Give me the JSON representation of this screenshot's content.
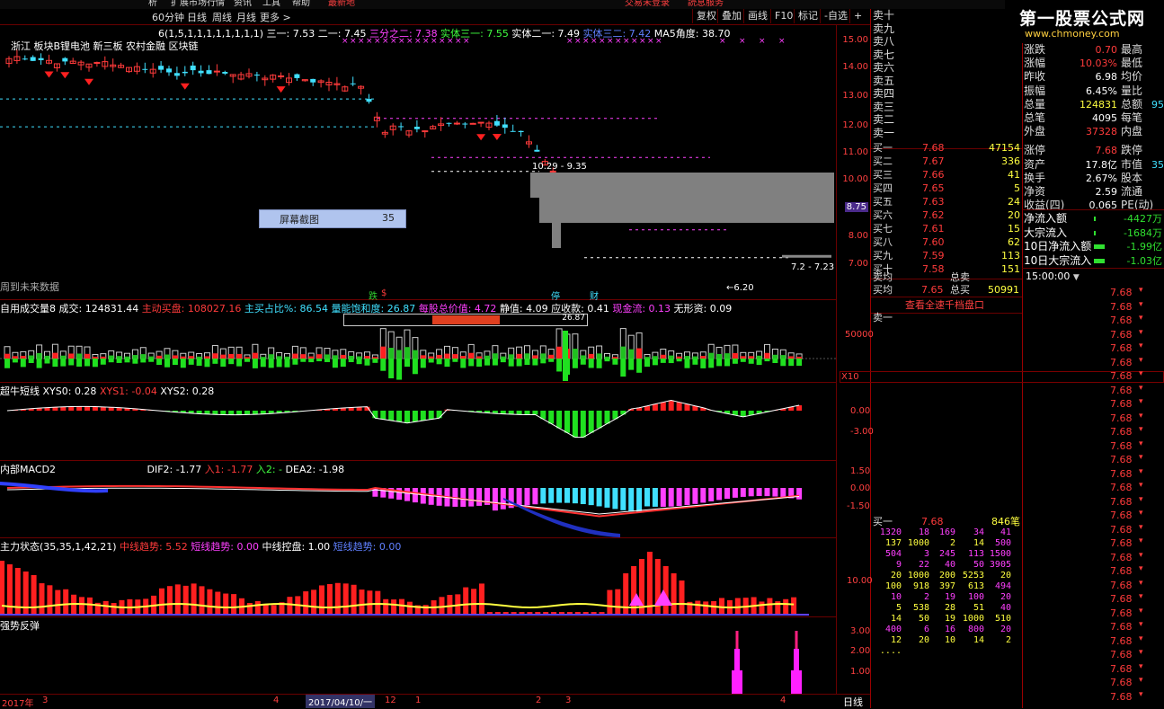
{
  "top_menu": [
    "析",
    "扩展市场行情",
    "资讯",
    "工具",
    "帮助",
    "最新地",
    "交易未登录",
    "読息服务"
  ],
  "period_tabs": [
    "60分钟",
    "日线",
    "周线",
    "月线",
    "更多 >"
  ],
  "toolbar_right": [
    "复权",
    "叠加",
    "画线",
    "F10",
    "标记",
    "-自选",
    "+"
  ],
  "logo": {
    "title": "第一股票公式网",
    "url": "www.chmoney.com"
  },
  "main_chart": {
    "legend_params": "6(1,5,1,1,1,1,1,1,1,1)",
    "legend_items": [
      {
        "label": "三一: 7.53",
        "color": "#ffffff"
      },
      {
        "label": "二一: 7.45",
        "color": "#ffffff"
      },
      {
        "label": "三分之二: 7.38",
        "color": "#ff40ff"
      },
      {
        "label": "实体三一: 7.55",
        "color": "#40ff40"
      },
      {
        "label": "实体二一: 7.49",
        "color": "#ffffff"
      },
      {
        "label": "实体三二: 7.42",
        "color": "#6080ff"
      },
      {
        "label": "MA5角度: 38.70",
        "color": "#ffffff"
      }
    ],
    "concept_tags": "浙江 板块B锂电池 新三板 农村金融 区块链",
    "price_ticks": [
      "15.00",
      "14.00",
      "13.00",
      "12.00",
      "11.00",
      "10.00",
      "8.75",
      "8.00",
      "7.00"
    ],
    "labels": {
      "range1": "10.29 - 9.35",
      "range2": "7.2 - 7.23",
      "low": "←6.20",
      "no_data": "周到未来数据"
    },
    "screenshot_tool": {
      "label": "屏幕截图",
      "value": "35"
    }
  },
  "signals_row": {
    "d": "跌",
    "s": "$",
    "t": "停",
    "c": "财"
  },
  "volume_panel": {
    "title": "自用成交量8",
    "items": [
      {
        "label": "成交: 124831.44",
        "color": "#ffffff"
      },
      {
        "label": "主动买盘: 108027.16",
        "color": "#ff3b3b"
      },
      {
        "label": "主买占比%: 86.54",
        "color": "#40e0ff"
      },
      {
        "label": "量能饱和度: 26.87",
        "color": "#40e0ff"
      },
      {
        "label": "每股总价值: 4.72",
        "color": "#ff40ff"
      },
      {
        "label": "静值: 4.09",
        "color": "#ffffff"
      },
      {
        "label": "应收款: 0.41",
        "color": "#ffffff"
      },
      {
        "label": "现金流: 0.13",
        "color": "#ff40ff"
      },
      {
        "label": "无形资: 0.09",
        "color": "#ffffff"
      }
    ],
    "gauge_value": "26.87",
    "gauge_fraction": 0.2687,
    "ticks": [
      "50000",
      "X10"
    ]
  },
  "short_panel": {
    "title": "超牛短线",
    "items": [
      {
        "label": "XYS0: 0.28",
        "color": "#ffffff"
      },
      {
        "label": "XYS1: -0.04",
        "color": "#ff3b3b"
      },
      {
        "label": "XYS2: 0.28",
        "color": "#ffffff"
      }
    ],
    "ticks": [
      "0.00",
      "-3.00"
    ]
  },
  "macd_panel": {
    "title": "内部MACD2",
    "items": [
      {
        "label": "DIF2: -1.77",
        "color": "#ffffff"
      },
      {
        "label": "入1: -1.77",
        "color": "#ff3b3b"
      },
      {
        "label": "入2: -",
        "color": "#40ff40"
      },
      {
        "label": "DEA2: -1.98",
        "color": "#ffffff"
      }
    ],
    "ticks": [
      "1.50",
      "0.00",
      "-1.50"
    ]
  },
  "main_force_panel": {
    "title": "主力状态(35,35,1,42,21)",
    "items": [
      {
        "label": "中线趋势: 5.52",
        "color": "#ff3b3b"
      },
      {
        "label": "短线趋势: 0.00",
        "color": "#ff40ff"
      },
      {
        "label": "中线控盘: 1.00",
        "color": "#ffffff"
      },
      {
        "label": "短线趋势: 0.00",
        "color": "#6080ff"
      }
    ],
    "ticks": [
      "10.00"
    ]
  },
  "reversal_panel": {
    "title": "强势反弹",
    "ticks": [
      "3.00",
      "2.00",
      "1.00"
    ]
  },
  "bottom_axis": {
    "labels": [
      "2017年",
      "3",
      "4",
      "2017/04/10/一",
      "12",
      "1",
      "2",
      "3",
      "4"
    ],
    "period": "日线"
  },
  "order_book": {
    "sell": [
      "卖十",
      "卖九",
      "卖八",
      "卖七",
      "卖六",
      "卖五",
      "卖四",
      "卖三",
      "卖二",
      "卖一"
    ],
    "buy": [
      {
        "label": "买一",
        "price": "7.68",
        "vol": "47154"
      },
      {
        "label": "买二",
        "price": "7.67",
        "vol": "336"
      },
      {
        "label": "买三",
        "price": "7.66",
        "vol": "41"
      },
      {
        "label": "买四",
        "price": "7.65",
        "vol": "5"
      },
      {
        "label": "买五",
        "price": "7.63",
        "vol": "24"
      },
      {
        "label": "买六",
        "price": "7.62",
        "vol": "20"
      },
      {
        "label": "买七",
        "price": "7.61",
        "vol": "15"
      },
      {
        "label": "买八",
        "price": "7.60",
        "vol": "62"
      },
      {
        "label": "买九",
        "price": "7.59",
        "vol": "113"
      },
      {
        "label": "买十",
        "price": "7.58",
        "vol": "151"
      }
    ],
    "avg_sell": "卖均",
    "total_sell": "总卖",
    "avg_buy": "买均",
    "avg_buy_price": "7.65",
    "total_buy": "总买",
    "total_buy_vol": "50991",
    "view_all": "查看全速千档盘口",
    "sell1": "卖一",
    "buy1_label": "买一",
    "buy1_price": "7.68",
    "buy1_count": "846笔",
    "queue": [
      [
        "1320",
        "18",
        "169",
        "34",
        "41"
      ],
      [
        "137",
        "1000",
        "2",
        "14",
        "500"
      ],
      [
        "504",
        "3",
        "245",
        "113",
        "1500"
      ],
      [
        "9",
        "22",
        "40",
        "50",
        "3905"
      ],
      [
        "20",
        "1000",
        "200",
        "5253",
        "20"
      ],
      [
        "100",
        "918",
        "397",
        "613",
        "494"
      ],
      [
        "10",
        "2",
        "19",
        "100",
        "20"
      ],
      [
        "5",
        "538",
        "28",
        "51",
        "40"
      ],
      [
        "14",
        "50",
        "19",
        "1000",
        "510"
      ],
      [
        "400",
        "6",
        "16",
        "800",
        "20"
      ],
      [
        "12",
        "20",
        "10",
        "14",
        "2"
      ],
      [
        "....",
        "",
        "",
        "",
        ""
      ]
    ]
  },
  "stats": [
    {
      "l": "涨跌",
      "v": "0.70",
      "vc": "#ff3b3b",
      "l2": "最高",
      "v2": ""
    },
    {
      "l": "涨幅",
      "v": "10.03%",
      "vc": "#ff3b3b",
      "l2": "最低",
      "v2": ""
    },
    {
      "l": "昨收",
      "v": "6.98",
      "vc": "#ffffff",
      "l2": "均价",
      "v2": ""
    },
    {
      "l": "振幅",
      "v": "6.45%",
      "vc": "#ffffff",
      "l2": "量比",
      "v2": ""
    },
    {
      "l": "总量",
      "v": "124831",
      "vc": "#ffff40",
      "l2": "总额",
      "v2": "95"
    },
    {
      "l": "总笔",
      "v": "4095",
      "vc": "#ffffff",
      "l2": "每笔",
      "v2": ""
    },
    {
      "l": "外盘",
      "v": "37328",
      "vc": "#ff3b3b",
      "l2": "内盘",
      "v2": ""
    },
    {
      "l": "涨停",
      "v": "7.68",
      "vc": "#ff3b3b",
      "l2": "跌停",
      "v2": ""
    },
    {
      "l": "资产",
      "v": "17.8亿",
      "vc": "#ffffff",
      "l2": "市值",
      "v2": "35"
    },
    {
      "l": "换手",
      "v": "2.67%",
      "vc": "#ffffff",
      "l2": "股本",
      "v2": ""
    },
    {
      "l": "净资",
      "v": "2.59",
      "vc": "#ffffff",
      "l2": "流通",
      "v2": ""
    },
    {
      "l": "收益(四)",
      "v": "0.065",
      "vc": "#ffffff",
      "l2": "PE(动)",
      "v2": ""
    }
  ],
  "flows": [
    {
      "l": "净流入额",
      "v": "-4427万"
    },
    {
      "l": "大宗流入",
      "v": "-1684万"
    },
    {
      "l": "10日净流入额",
      "v": "-1.99亿"
    },
    {
      "l": "10日大宗流入",
      "v": "-1.03亿"
    }
  ],
  "ticks_list": {
    "time": "15:00:00",
    "price": "7.68"
  },
  "colors": {
    "up": "#ff3b3b",
    "down": "#30d030",
    "grid": "#6a0000",
    "bg": "#000000"
  }
}
